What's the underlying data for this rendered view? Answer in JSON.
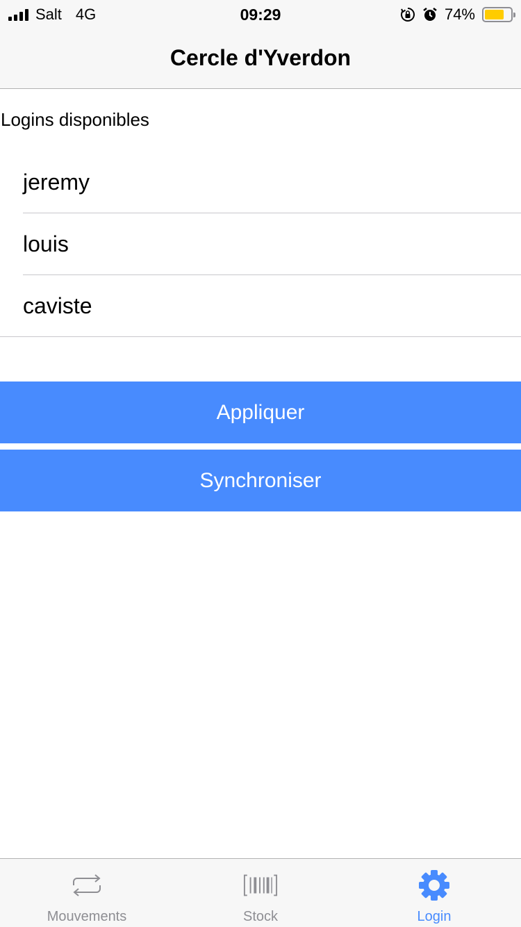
{
  "status_bar": {
    "carrier": "Salt",
    "network": "4G",
    "time": "09:29",
    "battery_percent": "74%",
    "battery_level": 0.74,
    "battery_color": "#ffcc00"
  },
  "nav": {
    "title": "Cercle d'Yverdon"
  },
  "logins": {
    "section_label": "Logins disponibles",
    "items": [
      "jeremy",
      "louis",
      "caviste"
    ]
  },
  "actions": {
    "apply_label": "Appliquer",
    "sync_label": "Synchroniser",
    "button_color": "#488bfe"
  },
  "tabs": [
    {
      "label": "Mouvements",
      "icon": "repeat-arrows-icon",
      "active": false
    },
    {
      "label": "Stock",
      "icon": "barcode-icon",
      "active": false
    },
    {
      "label": "Login",
      "icon": "gear-icon",
      "active": true
    }
  ]
}
